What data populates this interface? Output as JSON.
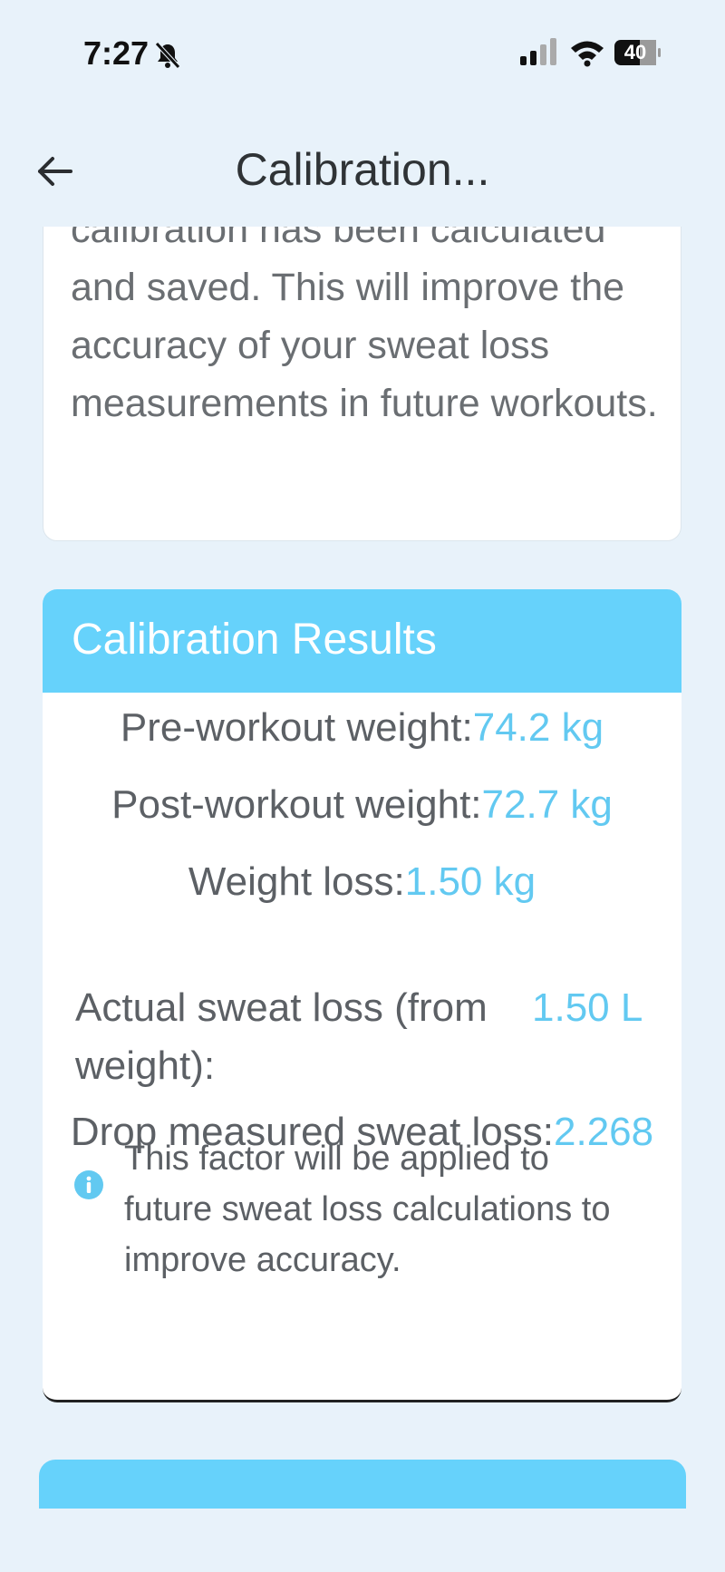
{
  "status_bar": {
    "time": "7:27",
    "battery": "40"
  },
  "header": {
    "title": "Calibration..."
  },
  "intro_card": {
    "text": "calibration has been calculated and saved. This will improve the accuracy of your sweat loss measurements in future workouts."
  },
  "results": {
    "title": "Calibration Results",
    "pre_label": "Pre-workout weight:",
    "pre_value": "74.2 kg",
    "post_label": "Post-workout weight:",
    "post_value": "72.7 kg",
    "loss_label": "Weight loss:",
    "loss_value": "1.50 kg",
    "actual_label": "Actual sweat loss (from weight):",
    "actual_value": "1.50 L",
    "drop_label": "Drop measured sweat loss:",
    "drop_value": "2.268",
    "info_text": "This factor will be applied to future sweat loss calculations to improve accuracy."
  },
  "colors": {
    "accent": "#66d2fb",
    "value": "#62c9f1",
    "background": "#e8f2fa"
  }
}
